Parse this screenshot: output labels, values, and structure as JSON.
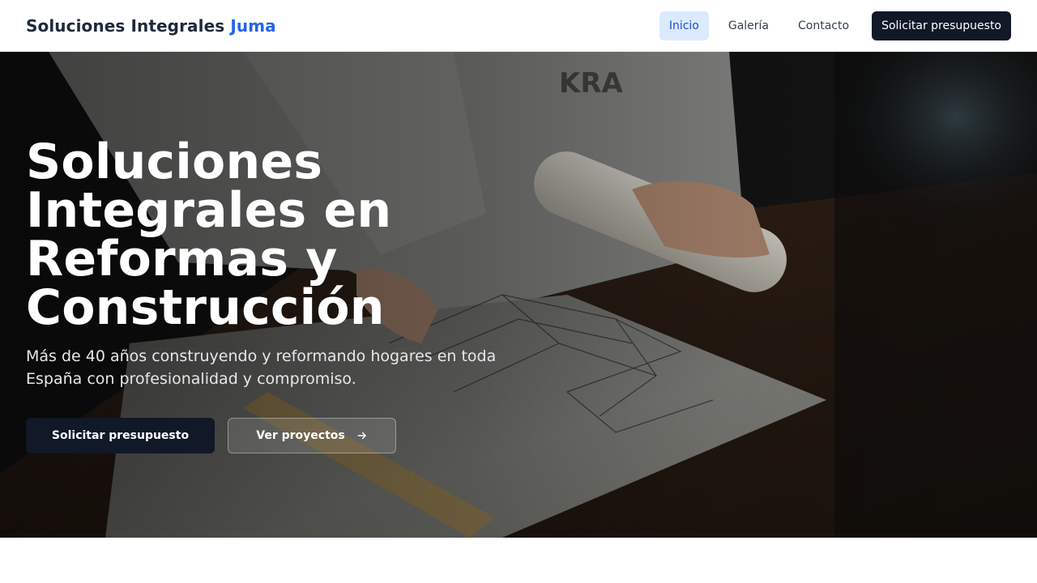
{
  "navbar": {
    "brand_main": "Soluciones Integrales",
    "brand_accent": "Juma",
    "links": [
      {
        "label": "Inicio",
        "active": true
      },
      {
        "label": "Galería",
        "active": false
      },
      {
        "label": "Contacto",
        "active": false
      }
    ],
    "cta_label": "Solicitar presupuesto"
  },
  "hero": {
    "title_lines": [
      "Soluciones",
      "Integrales en",
      "Reformas y",
      "Construcción"
    ],
    "subtitle": "Más de 40 años construyendo y reformando hogares en toda España con profesionalidad y compromiso.",
    "primary_button": "Solicitar presupuesto",
    "secondary_button": "Ver proyectos",
    "secondary_icon": "arrow-right-icon",
    "background_image": "architect-drawing-blueprints-photo"
  },
  "colors": {
    "brand_accent": "#2563eb",
    "dark": "#111827",
    "active_nav_bg": "#dbeafe"
  }
}
